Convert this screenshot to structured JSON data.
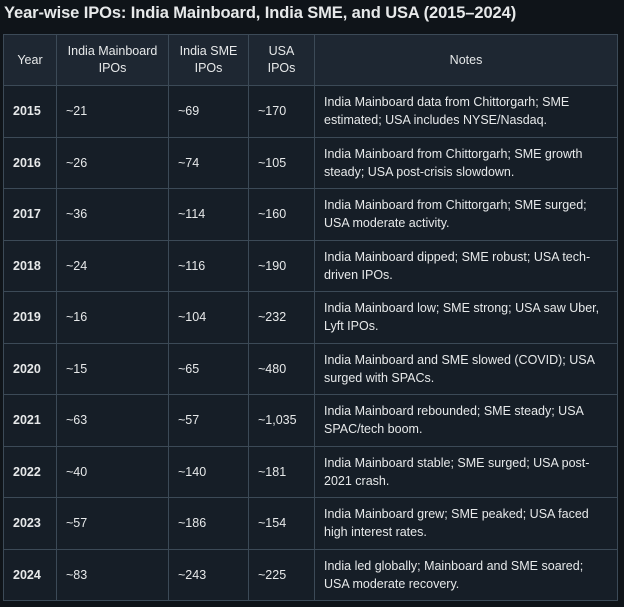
{
  "title": "Year-wise IPOs: India Mainboard, India SME, and USA (2015–2024)",
  "headers": {
    "year": "Year",
    "mainboard": "India Mainboard IPOs",
    "sme": "India SME IPOs",
    "usa": "USA IPOs",
    "notes": "Notes"
  },
  "rows": [
    {
      "year": "2015",
      "mainboard": "~21",
      "sme": "~69",
      "usa": "~170",
      "notes": "India Mainboard data from Chittorgarh; SME estimated; USA includes NYSE/Nasdaq."
    },
    {
      "year": "2016",
      "mainboard": "~26",
      "sme": "~74",
      "usa": "~105",
      "notes": "India Mainboard from Chittorgarh; SME growth steady; USA post-crisis slowdown."
    },
    {
      "year": "2017",
      "mainboard": "~36",
      "sme": "~114",
      "usa": "~160",
      "notes": "India Mainboard from Chittorgarh; SME surged; USA moderate activity."
    },
    {
      "year": "2018",
      "mainboard": "~24",
      "sme": "~116",
      "usa": "~190",
      "notes": "India Mainboard dipped; SME robust; USA tech-driven IPOs."
    },
    {
      "year": "2019",
      "mainboard": "~16",
      "sme": "~104",
      "usa": "~232",
      "notes": "India Mainboard low; SME strong; USA saw Uber, Lyft IPOs."
    },
    {
      "year": "2020",
      "mainboard": "~15",
      "sme": "~65",
      "usa": "~480",
      "notes": "India Mainboard and SME slowed (COVID); USA surged with SPACs."
    },
    {
      "year": "2021",
      "mainboard": "~63",
      "sme": "~57",
      "usa": "~1,035",
      "notes": "India Mainboard rebounded; SME steady; USA SPAC/tech boom."
    },
    {
      "year": "2022",
      "mainboard": "~40",
      "sme": "~140",
      "usa": "~181",
      "notes": "India Mainboard stable; SME surged; USA post-2021 crash."
    },
    {
      "year": "2023",
      "mainboard": "~57",
      "sme": "~186",
      "usa": "~154",
      "notes": "India Mainboard grew; SME peaked; USA faced high interest rates."
    },
    {
      "year": "2024",
      "mainboard": "~83",
      "sme": "~243",
      "usa": "~225",
      "notes": "India led globally; Mainboard and SME soared; USA moderate recovery."
    }
  ]
}
